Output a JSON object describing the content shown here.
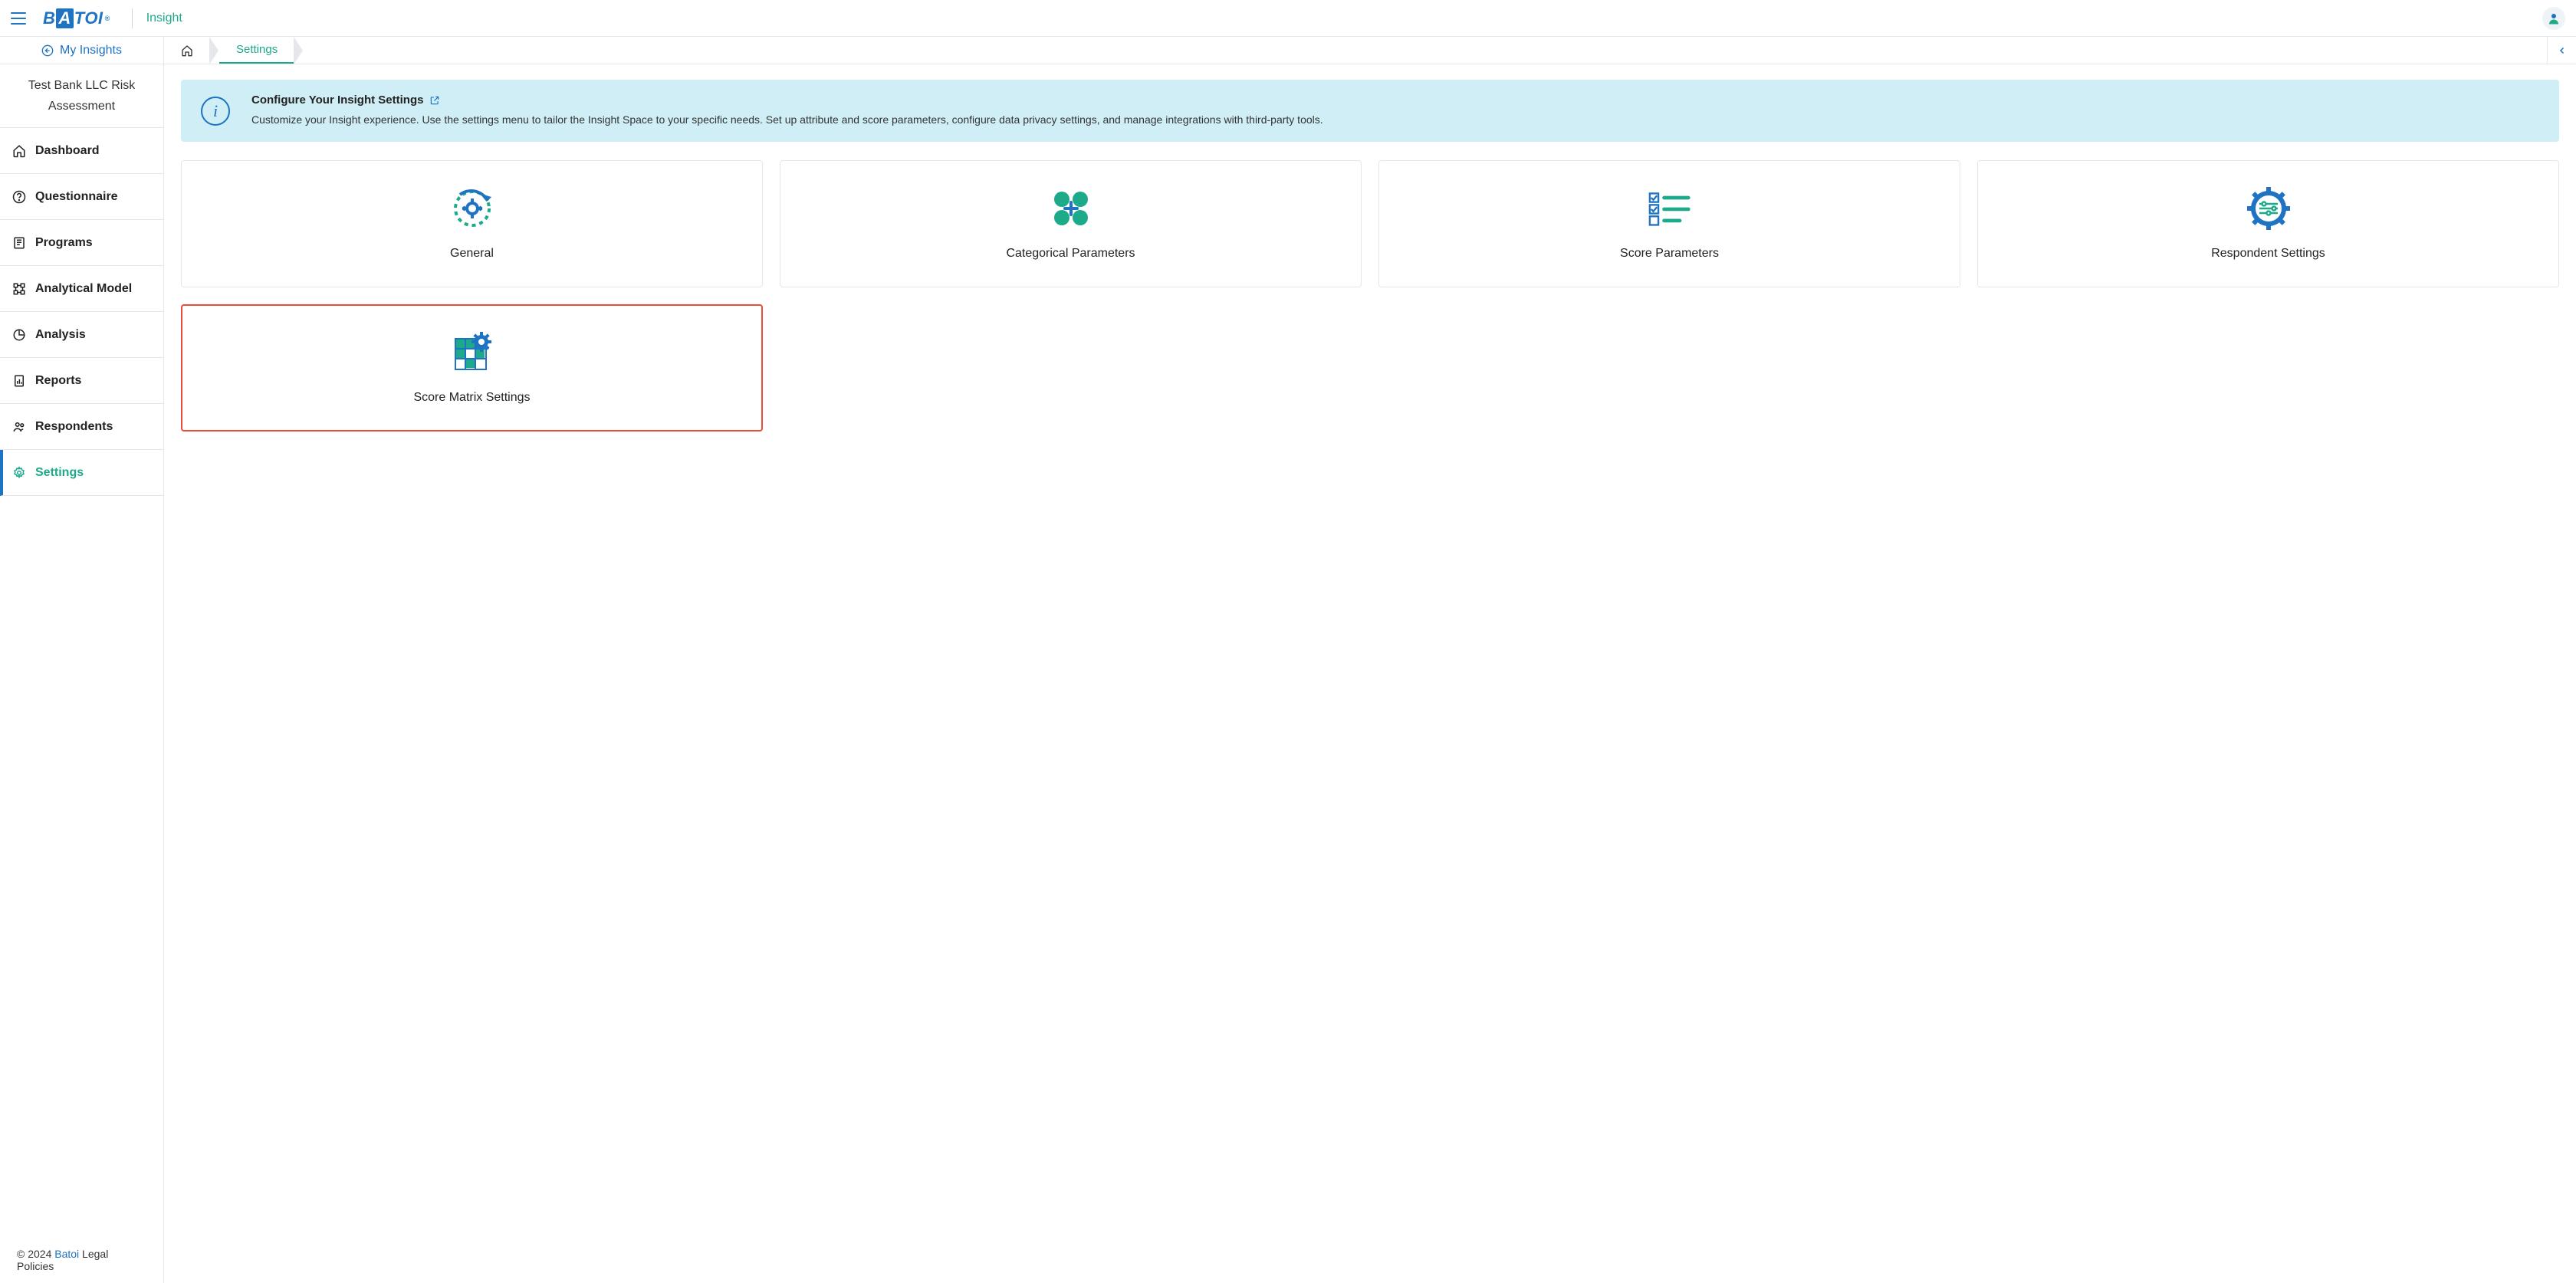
{
  "header": {
    "logo_text_pre": "B",
    "logo_text_boxed": "A",
    "logo_text_post": "TOI",
    "app_name": "Insight"
  },
  "sidebar": {
    "my_insights": "My Insights",
    "project_title": "Test Bank LLC Risk Assessment",
    "items": [
      {
        "label": "Dashboard"
      },
      {
        "label": "Questionnaire"
      },
      {
        "label": "Programs"
      },
      {
        "label": "Analytical Model"
      },
      {
        "label": "Analysis"
      },
      {
        "label": "Reports"
      },
      {
        "label": "Respondents"
      },
      {
        "label": "Settings"
      }
    ]
  },
  "breadcrumb": {
    "current": "Settings"
  },
  "banner": {
    "title": "Configure Your Insight Settings",
    "description": "Customize your Insight experience. Use the settings menu to tailor the Insight Space to your specific needs. Set up attribute and score parameters, configure data privacy settings, and manage integrations with third-party tools."
  },
  "cards": [
    {
      "label": "General"
    },
    {
      "label": "Categorical Parameters"
    },
    {
      "label": "Score Parameters"
    },
    {
      "label": "Respondent Settings"
    },
    {
      "label": "Score Matrix Settings"
    }
  ],
  "footer": {
    "copyright_pre": "© 2024 ",
    "link": "Batoi",
    "copyright_post": " Legal Policies"
  }
}
